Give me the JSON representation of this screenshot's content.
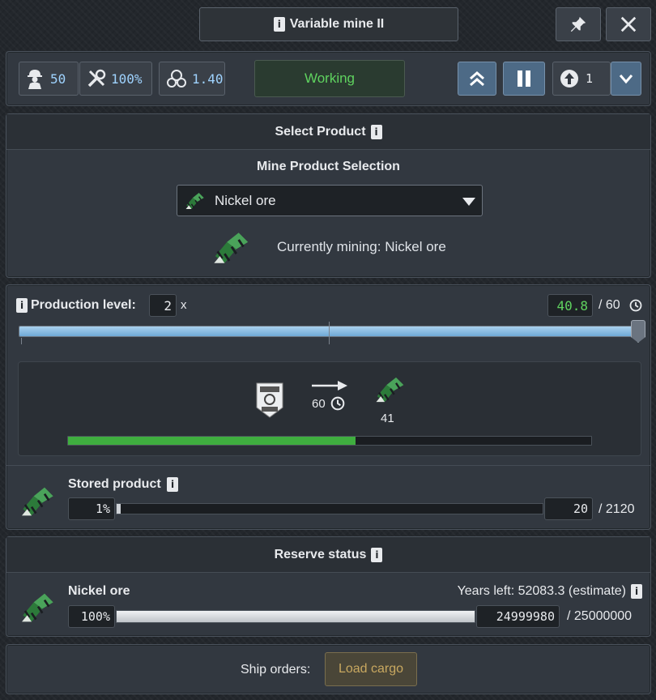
{
  "title": "Variable mine II",
  "toolbar": {
    "workers": "50",
    "maintenance": "100%",
    "unity": "1.40",
    "status": "Working",
    "upgrade_value": "1"
  },
  "select_product": {
    "header": "Select Product",
    "subtitle": "Mine Product Selection",
    "selected": "Nickel ore",
    "currently_mining": "Currently mining: Nickel ore"
  },
  "production": {
    "label": "Production level:",
    "level": "2",
    "level_suffix": "x",
    "current": "40.8",
    "max": "/ 60",
    "slider_fraction": 1.0,
    "recipe_input_icon": "coming-soon-icon",
    "recipe_time": "60",
    "recipe_output_qty": "41",
    "progress_fraction": 0.55
  },
  "stored": {
    "label": "Stored product",
    "percent": "1%",
    "fill_fraction": 0.01,
    "amount": "20",
    "capacity": "/ 2120"
  },
  "reserve": {
    "header": "Reserve status",
    "resource": "Nickel ore",
    "years_left": "Years left: 52083.3 (estimate)",
    "percent": "100%",
    "fill_fraction": 1.0,
    "amount": "24999980",
    "capacity": "/ 25000000"
  },
  "ship": {
    "label": "Ship orders:",
    "button": "Load cargo"
  },
  "colors": {
    "accent_green": "#5fd35f",
    "progress_green": "#3fae3f",
    "slider_blue": "#8bbbe0",
    "gold": "#c8a860"
  }
}
